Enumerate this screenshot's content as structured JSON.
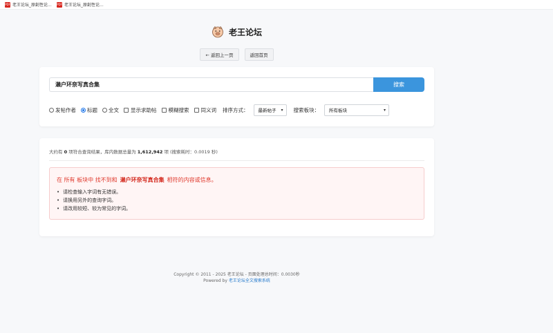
{
  "tabs": [
    {
      "icon": "pdf-file-icon",
      "label": "老王论坛_原創性论..."
    },
    {
      "icon": "pdf-file-icon",
      "label": "老王论坛_原創性论..."
    }
  ],
  "header": {
    "logo_icon": "pig-face-icon",
    "title": "老王论坛"
  },
  "nav": {
    "back_label": "← 返回上一页",
    "home_label": "返回首页"
  },
  "search": {
    "value": "濑户环奈写真合集",
    "button_label": "搜索",
    "mode_author": "发帖作者",
    "mode_title": "标题",
    "mode_fulltext": "全文",
    "mode_selected": "标题",
    "opt_help": "显示求助帖",
    "opt_fuzzy": "模糊搜索",
    "opt_synonym": "同义词",
    "sort_label": "排序方式：",
    "sort_value": "最新帖子",
    "board_label": "搜索板块：",
    "board_value": "所有板块"
  },
  "stats": {
    "prefix": "大约有",
    "count": "0",
    "mid": "项符合查询结果，库内数据总量为",
    "total": "1,612,942",
    "suffix": "项 (搜索耗时：0.0019 秒)"
  },
  "not_found": {
    "prefix": "在 所有 板块中 找不到和",
    "keyword": "濑户环奈写真合集",
    "suffix": "相符的内容或信息。",
    "tips": [
      "请检查输入字词有无错误。",
      "请换用另外的查询字词。",
      "请改用较短、较为常见的字词。"
    ]
  },
  "footer": {
    "line1": "Copyright © 2011 - 2025 老王论坛 - 页面处理总时间：0.0030秒",
    "powered_prefix": "Powered by",
    "powered_link": "老王论坛全文搜索系统"
  },
  "colors": {
    "accent": "#3b95dd",
    "error": "#e03b2f",
    "error_bg": "#fff5f5"
  }
}
